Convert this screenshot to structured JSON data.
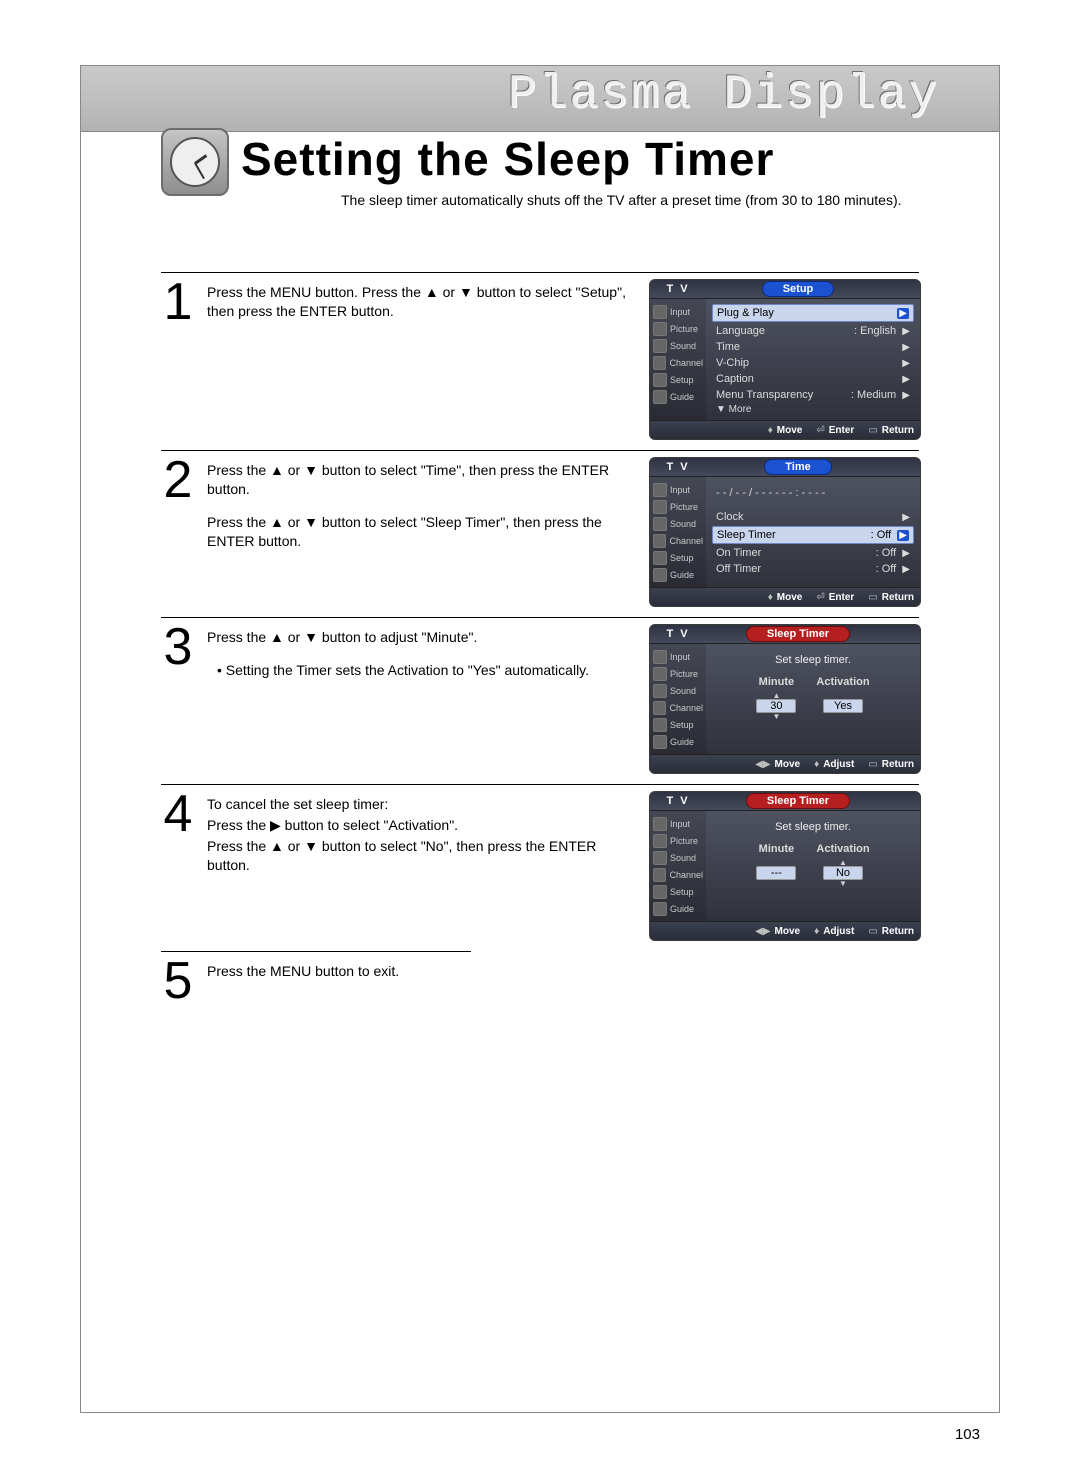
{
  "header": {
    "banner": "Plasma Display",
    "title": "Setting the Sleep Timer",
    "subtitle": "The sleep timer automatically shuts off the TV after a preset time (from 30 to 180 minutes)."
  },
  "steps": {
    "s1": {
      "num": "1",
      "p1": "Press the MENU button. Press the ▲ or ▼ button to select \"Setup\", then press the ENTER button."
    },
    "s2": {
      "num": "2",
      "p1": "Press the ▲ or ▼ button to select \"Time\", then press the ENTER button.",
      "p2": "Press the ▲ or ▼ button to select \"Sleep Timer\", then press the ENTER button."
    },
    "s3": {
      "num": "3",
      "p1": "Press the ▲ or ▼ button to adjust \"Minute\".",
      "p2": "• Setting the Timer sets the Activation to \"Yes\" automatically."
    },
    "s4": {
      "num": "4",
      "p1": "To cancel the set sleep timer:",
      "p2": "Press the ▶ button to select \"Activation\".",
      "p3": "Press the ▲ or ▼ button to select \"No\", then press the ENTER button."
    },
    "s5": {
      "num": "5",
      "p1": "Press the MENU button to exit."
    }
  },
  "osd_common": {
    "tv": "T V",
    "sidebar": [
      "Input",
      "Picture",
      "Sound",
      "Channel",
      "Setup",
      "Guide"
    ],
    "move": "Move",
    "enter": "Enter",
    "adjust": "Adjust",
    "return": "Return"
  },
  "osd1": {
    "title": "Setup",
    "items": [
      {
        "label": "Plug & Play",
        "value": "",
        "active": true
      },
      {
        "label": "Language",
        "value": ": English"
      },
      {
        "label": "Time",
        "value": ""
      },
      {
        "label": "V-Chip",
        "value": ""
      },
      {
        "label": "Caption",
        "value": ""
      },
      {
        "label": "Menu Transparency",
        "value": ": Medium"
      }
    ],
    "more": "▼ More"
  },
  "osd2": {
    "title": "Time",
    "clock_line": "- - / - - / - - - -   - -  :  - -   - -",
    "items": [
      {
        "label": "Clock",
        "value": ""
      },
      {
        "label": "Sleep Timer",
        "value": ": Off",
        "active": true
      },
      {
        "label": "On Timer",
        "value": ": Off"
      },
      {
        "label": "Off Timer",
        "value": ": Off"
      }
    ]
  },
  "osd3": {
    "title": "Sleep Timer",
    "msg": "Set sleep timer.",
    "minute_label": "Minute",
    "activation_label": "Activation",
    "minute": "30",
    "activation": "Yes"
  },
  "osd4": {
    "title": "Sleep Timer",
    "msg": "Set sleep timer.",
    "minute_label": "Minute",
    "activation_label": "Activation",
    "minute": "---",
    "activation": "No"
  },
  "page_num": "103"
}
